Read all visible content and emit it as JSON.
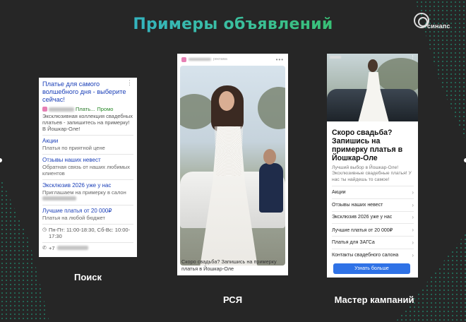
{
  "slide": {
    "title": "Примеры объявлений",
    "logo_text": "синапс",
    "accent_colors": {
      "title_start": "#2aa4e8",
      "title_end": "#35c33c",
      "pattern": "#1fae8a",
      "button": "#2f72e6"
    }
  },
  "captions": {
    "search": "Поиск",
    "rsya": "РСЯ",
    "master": "Мастер кампаний"
  },
  "search_ad": {
    "headline": "Платье для самого волшебного дня - выберите сейчас!",
    "domain": "Плать...",
    "promo": "Промо",
    "description": "Эксклюзивная коллекция свадебных платьев - запишитесь на примерку! В Йошкар-Оле!",
    "sitelinks": [
      {
        "title": "Акции",
        "desc": "Платья по приятной цене"
      },
      {
        "title": "Отзывы наших невест",
        "desc": "Обратная связь от наших любимых клиентов"
      },
      {
        "title": "Эксклюзив 2026 уже у нас",
        "desc": "Приглашаем на примерку в салон"
      },
      {
        "title": "Лучшие платья от 20 000₽",
        "desc": "Платья на любой бюджет"
      }
    ],
    "hours": "Пн-Пт: 11:00-18:30, Сб-Вс: 10:00-17:30",
    "phone_prefix": "+7",
    "icons": {
      "clock": "clock-icon",
      "phone": "phone-icon",
      "menu": "kebab-icon"
    }
  },
  "rsya_ad": {
    "label": "реклама",
    "text": "Скоро свадьба? Запишись на примерку платья в Йошкар-Оле"
  },
  "master_ad": {
    "title": "Скоро свадьба? Запишись на примерку платья в Йошкар-Оле",
    "description": "Лучший выбор в Йошкар-Оле! Эксклюзивные свадебные платья! У нас ты найдешь то самое!",
    "items": [
      "Акции",
      "Отзывы наших невест",
      "Эксклюзив 2026 уже у нас",
      "Лучшие платья от 20 000₽",
      "Платья для ЗАГСа",
      "Контакты свадебного салона"
    ],
    "button": "Узнать больше"
  }
}
